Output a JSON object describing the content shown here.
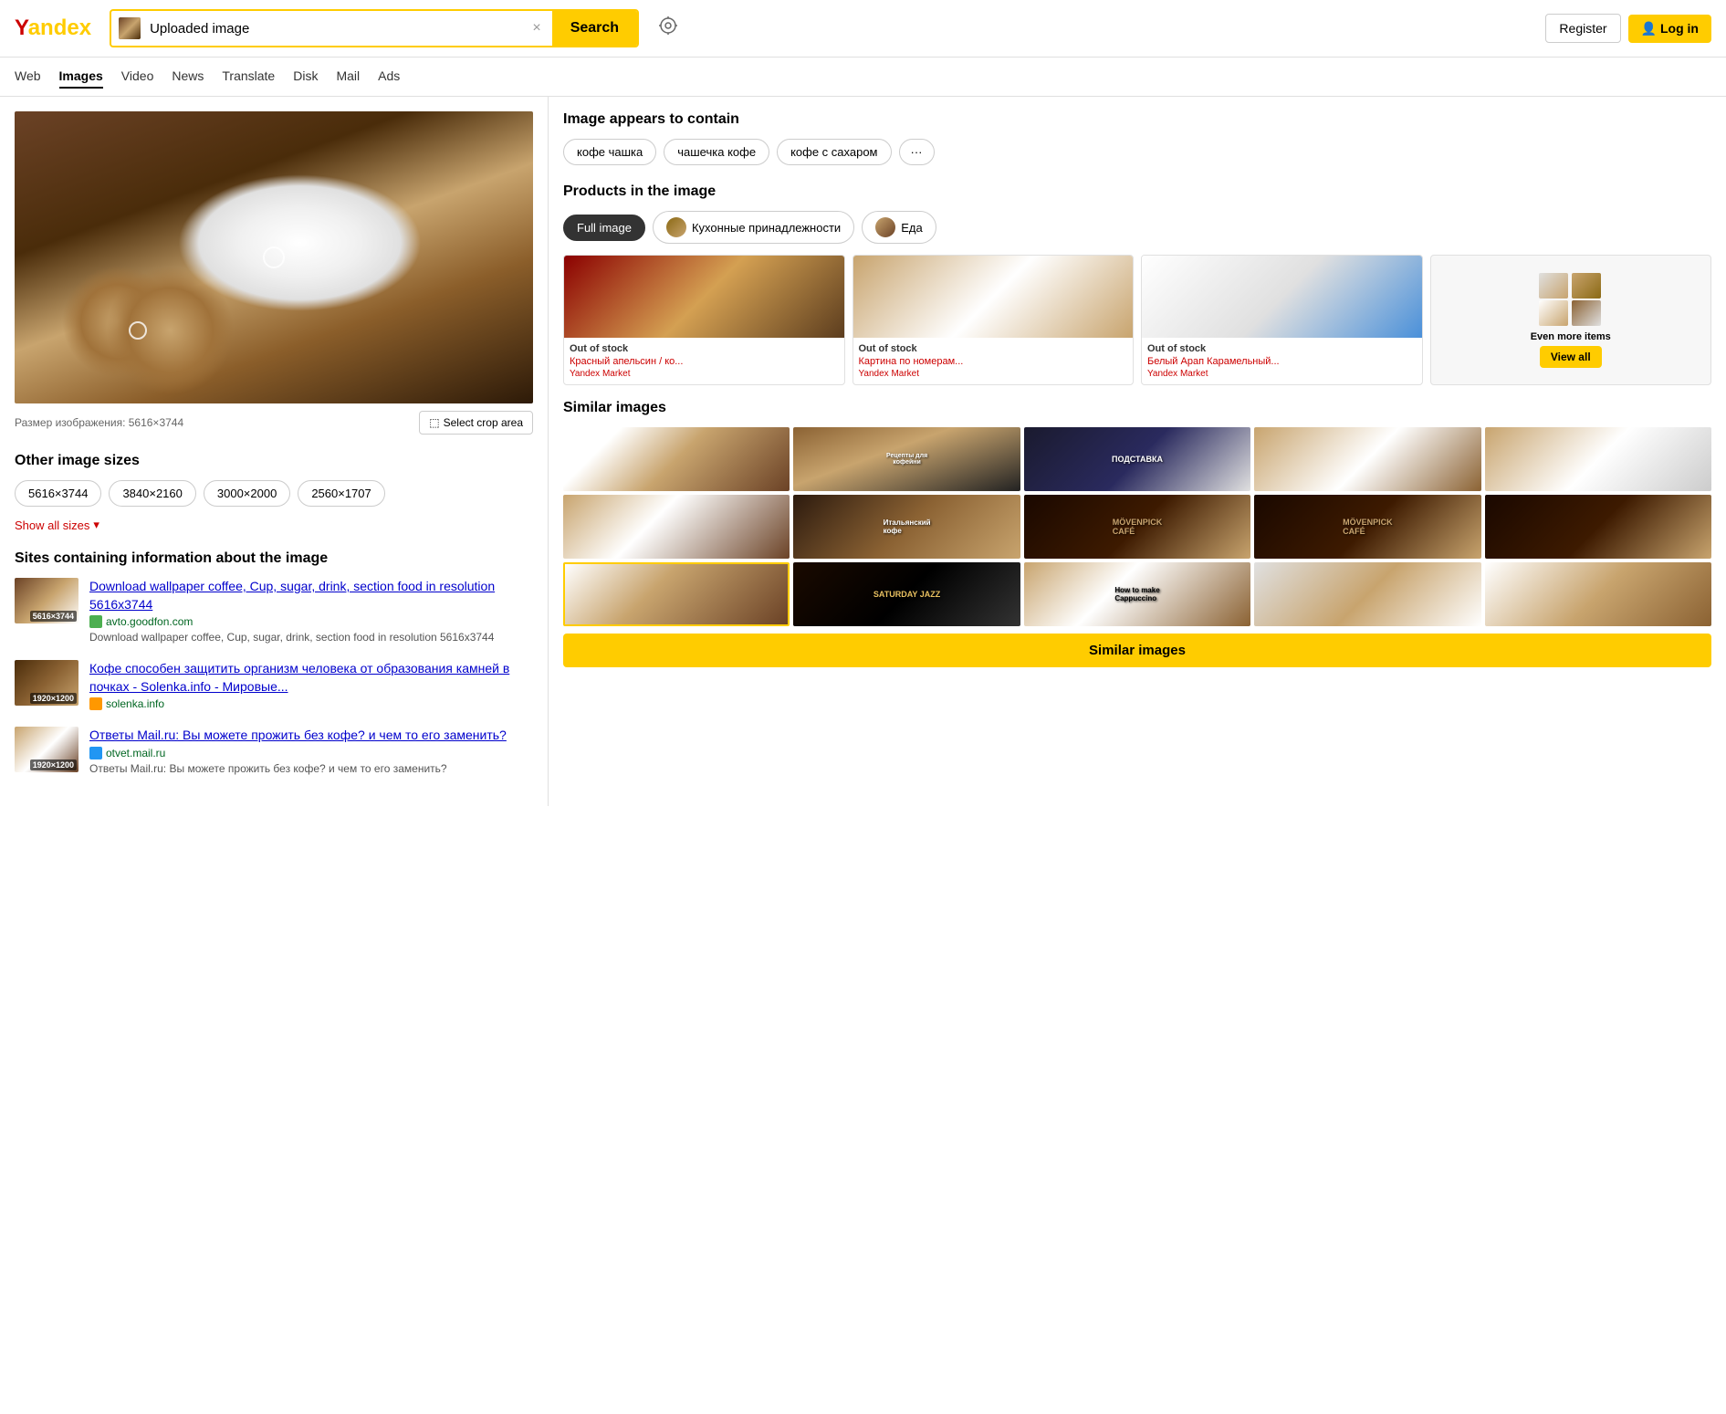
{
  "logo": {
    "text_y": "Y",
    "text_andex": "andex",
    "full": "Yandex"
  },
  "header": {
    "search_value": "Uploaded image",
    "search_btn": "Search",
    "register_btn": "Register",
    "login_btn": "Log in"
  },
  "nav": {
    "items": [
      {
        "label": "Web",
        "active": false
      },
      {
        "label": "Images",
        "active": true
      },
      {
        "label": "Video",
        "active": false
      },
      {
        "label": "News",
        "active": false
      },
      {
        "label": "Translate",
        "active": false
      },
      {
        "label": "Disk",
        "active": false
      },
      {
        "label": "Mail",
        "active": false
      },
      {
        "label": "Ads",
        "active": false
      }
    ]
  },
  "left_panel": {
    "image_meta": "Размер изображения: 5616×3744",
    "crop_btn": "Select crop area",
    "sizes_title": "Other image sizes",
    "sizes": [
      "5616×3744",
      "3840×2160",
      "3000×2000",
      "2560×1707"
    ],
    "show_all_link": "Show all sizes",
    "sites_title": "Sites containing information about the image",
    "sites": [
      {
        "thumb_label": "5616×3744",
        "link": "Download wallpaper coffee, Cup, sugar, drink, section food in resolution 5616x3744",
        "domain": "avto.goodfon.com",
        "icon_color": "green",
        "desc": "Download wallpaper coffee, Cup, sugar, drink, section food in resolution 5616x3744"
      },
      {
        "thumb_label": "1920×1200",
        "link": "Кофе способен защитить организм человека от образования камней в почках - Solenka.info - Мировые...",
        "domain": "solenka.info",
        "icon_color": "orange",
        "desc": ""
      },
      {
        "thumb_label": "1920×1200",
        "link": "Ответы Mail.ru: Вы можете прожить без кофе? и чем то его заменить?",
        "domain": "otvet.mail.ru",
        "icon_color": "blue",
        "desc": "Ответы Mail.ru: Вы можете прожить без кофе? и чем то его заменить?"
      }
    ]
  },
  "right_panel": {
    "tags_title": "Image appears to contain",
    "tags": [
      "кофе чашка",
      "чашечка кофе",
      "кофе с сахаром"
    ],
    "tags_more": "···",
    "products_title": "Products in the image",
    "product_filters": [
      {
        "label": "Full image",
        "active": true
      },
      {
        "label": "Кухонные принадлежности",
        "active": false
      },
      {
        "label": "Еда",
        "active": false
      }
    ],
    "products": [
      {
        "status": "Out of stock",
        "name": "Красный апельсин / ко...",
        "market": "Yandex Market"
      },
      {
        "status": "Out of stock",
        "name": "Картина по номерам...",
        "market": "Yandex Market"
      },
      {
        "status": "Out of stock",
        "name": "Белый Арап Карамельный...",
        "market": "Yandex Market"
      }
    ],
    "even_more_label": "Even more items",
    "view_all_btn": "View all",
    "similar_title": "Similar images",
    "similar_btn": "Similar images"
  }
}
